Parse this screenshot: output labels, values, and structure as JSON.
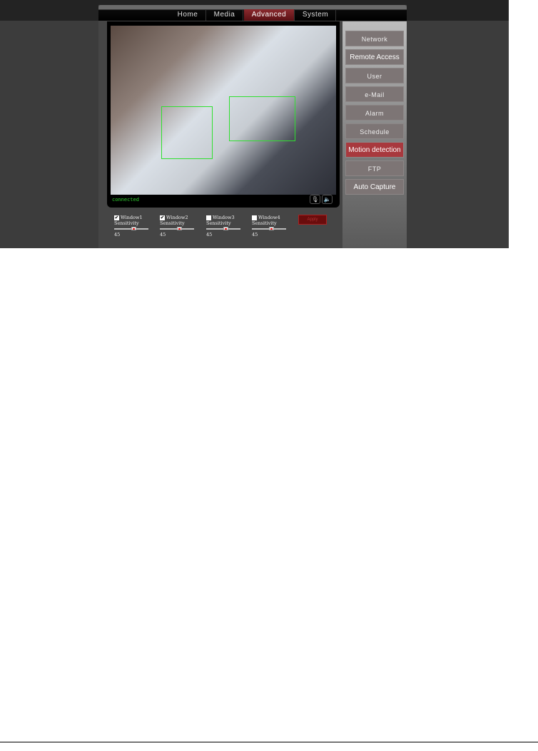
{
  "nav": {
    "items": [
      {
        "label": "Home"
      },
      {
        "label": "Media"
      },
      {
        "label": "Advanced",
        "active": true
      },
      {
        "label": "System"
      }
    ]
  },
  "video": {
    "status": "connected",
    "buttons": [
      "microphone-icon",
      "mute-speaker-icon"
    ]
  },
  "sidebar": {
    "items": [
      {
        "label": "Network"
      },
      {
        "label": "Remote Access"
      },
      {
        "label": "User"
      },
      {
        "label": "e-Mail"
      },
      {
        "label": "Alarm"
      },
      {
        "label": "Schedule"
      },
      {
        "label": "Motion detection",
        "active": true
      },
      {
        "label": "FTP"
      },
      {
        "label": "Auto Capture"
      }
    ]
  },
  "motion": {
    "windows": [
      {
        "label": "Window1",
        "checked": true,
        "sensitivity_label": "Sensitivity",
        "value": "45"
      },
      {
        "label": "Window2",
        "checked": true,
        "sensitivity_label": "Sensitivity",
        "value": "45"
      },
      {
        "label": "Window3",
        "checked": false,
        "sensitivity_label": "Sensitivity",
        "value": "45"
      },
      {
        "label": "Window4",
        "checked": false,
        "sensitivity_label": "Sensitivity",
        "value": "45"
      }
    ],
    "apply_label": "Apply"
  },
  "colors": {
    "accent": "#a8393e",
    "zone": "#2fe02f"
  }
}
